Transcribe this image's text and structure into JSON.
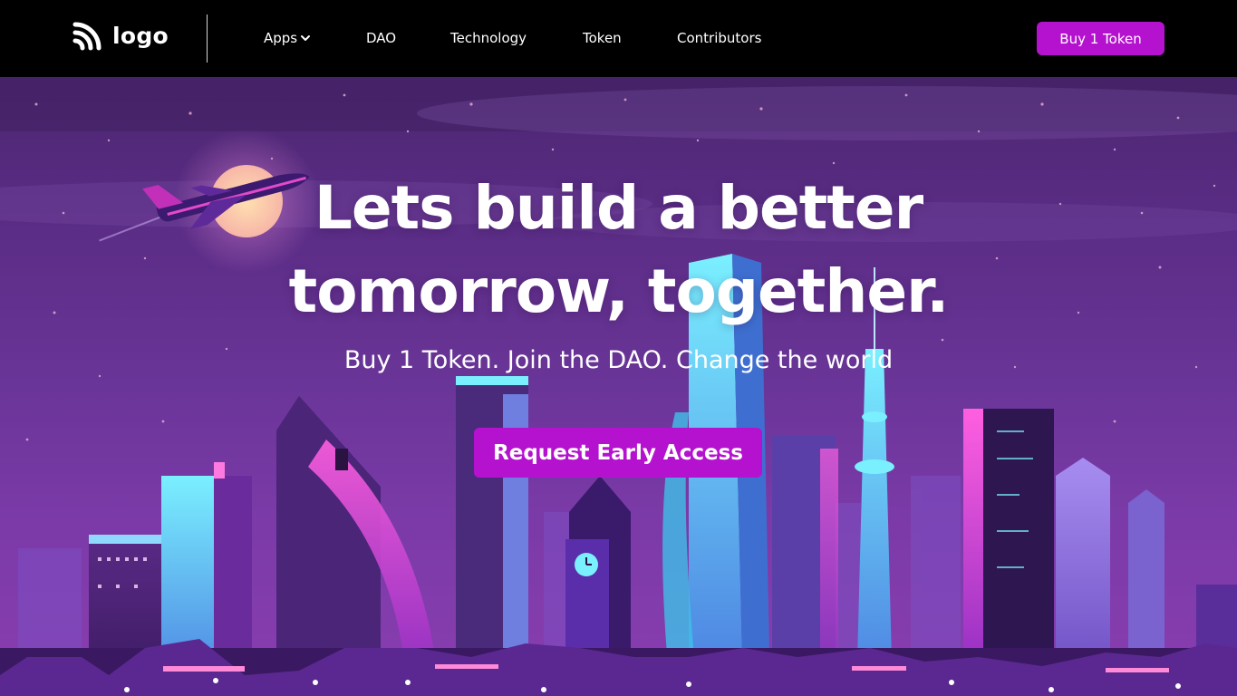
{
  "header": {
    "logo_text": "logo",
    "logo_icon": "rss-signal-icon",
    "nav": [
      {
        "label": "Apps",
        "has_dropdown": true
      },
      {
        "label": "DAO"
      },
      {
        "label": "Technology"
      },
      {
        "label": "Token"
      },
      {
        "label": "Contributors"
      }
    ],
    "buy_label": "Buy 1 Token"
  },
  "hero": {
    "title_line1": "Lets build a better",
    "title_line2": "tomorrow, together.",
    "subtitle": "Buy 1 Token. Join the DAO. Change the world",
    "cta_label": "Request Early Access",
    "illustration": "neon-city-skyline-with-airplane-and-moon"
  },
  "colors": {
    "accent": "#b512cf",
    "nav_bg": "#000000",
    "sky_top": "#4d2672",
    "sky_bottom": "#8a3db0"
  }
}
